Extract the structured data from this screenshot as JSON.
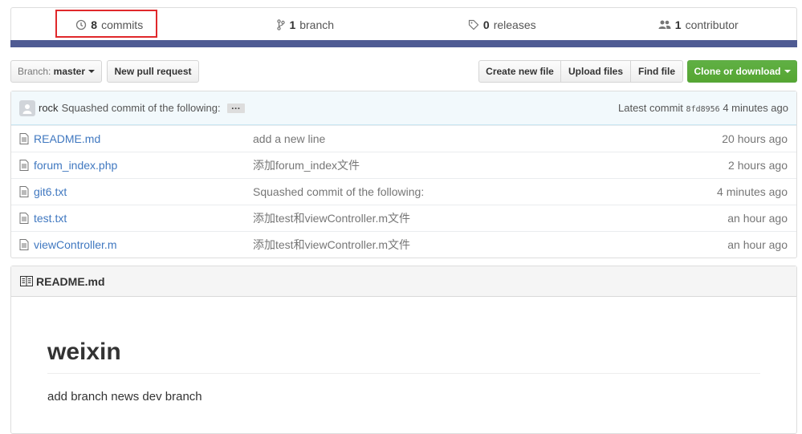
{
  "summary": {
    "commits": {
      "count": "8",
      "label": "commits",
      "icon": "history-icon"
    },
    "branches": {
      "count": "1",
      "label": "branch",
      "icon": "branch-icon"
    },
    "releases": {
      "count": "0",
      "label": "releases",
      "icon": "tag-icon"
    },
    "contributors": {
      "count": "1",
      "label": "contributor",
      "icon": "people-icon"
    },
    "lang_color": "#4f5b93",
    "highlight_color": "#e0282b"
  },
  "toolbar": {
    "branch_prefix": "Branch:",
    "branch_name": "master",
    "new_pr": "New pull request",
    "create_file": "Create new file",
    "upload_files": "Upload files",
    "find_file": "Find file",
    "clone": "Clone or download",
    "clone_color": "#60b044"
  },
  "commit": {
    "author": "rock",
    "message": "Squashed commit of the following:",
    "ellipsis": "…",
    "latest_label": "Latest commit",
    "sha": "8fd8956",
    "age": "4 minutes ago"
  },
  "files": [
    {
      "name": "README.md",
      "message": "add a new line",
      "age": "20 hours ago"
    },
    {
      "name": "forum_index.php",
      "message": "添加forum_index文件",
      "age": "2 hours ago"
    },
    {
      "name": "git6.txt",
      "message": "Squashed commit of the following:",
      "age": "4 minutes ago"
    },
    {
      "name": "test.txt",
      "message": "添加test和viewController.m文件",
      "age": "an hour ago"
    },
    {
      "name": "viewController.m",
      "message": "添加test和viewController.m文件",
      "age": "an hour ago"
    }
  ],
  "readme": {
    "title": "README.md",
    "heading": "weixin",
    "text": "add branch news dev branch"
  }
}
